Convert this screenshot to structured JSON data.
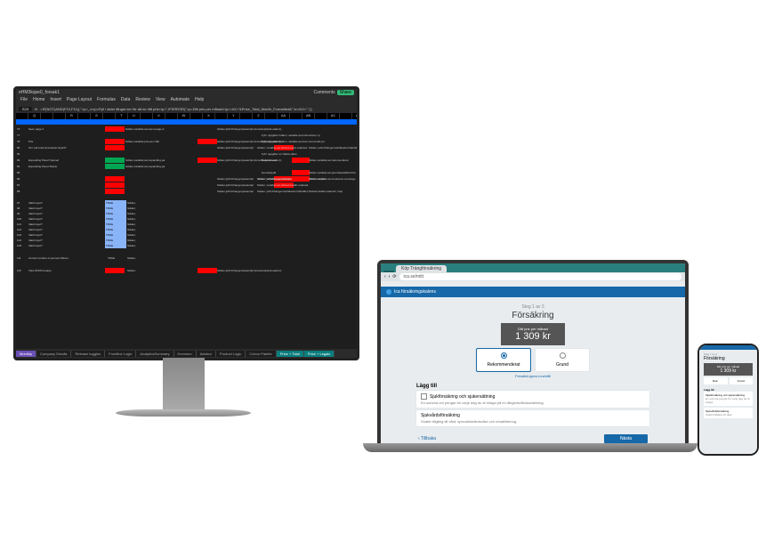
{
  "excel": {
    "filename": "eHM3kqse0_forsak1",
    "menu": [
      "File",
      "Home",
      "Insert",
      "Page Layout",
      "Formulas",
      "Data",
      "Review",
      "View",
      "Automate",
      "Help"
    ],
    "cell_ref": "B28",
    "formula": "=IF(NOT(AND(F10,F11)),\"<p>_x</p>Fyll i alder långst ner för att se ditt pris</p>\",IFERROR(\"<p>Ditt pris per månad</p><h2>\"&Price_Total_Month_Formatted&\" kr</h2>\",\"))",
    "comments_btn": "Comments",
    "share_btn": "Share",
    "columns": [
      "",
      "Q",
      "",
      "",
      "R",
      "",
      "S",
      "",
      "T",
      "U",
      "",
      "V",
      "",
      "W",
      "",
      "X",
      "",
      "Y",
      "",
      "Z",
      "",
      "AA",
      "",
      "AB",
      "",
      "AC",
      "",
      "AD"
    ],
    "rows_a": [
      {
        "n": "70",
        "label": "Seen page 2",
        "g": true,
        "txt": "hidden;variable;set;seen-page-2;",
        "r": true,
        "txt2": "hidden;jsOnChange=javascript;storeAnalyticsLoader();"
      },
      {
        "n": "77",
        "label": "",
        "txt3": "Fyll i uppgifter hidden; variable;set;instructions;<p"
      },
      {
        "n": "78",
        "label": "Pris",
        "r": true,
        "txt": "hidden;variable;pris-per-mån",
        "r2": true,
        "txt2": "hidden;jsOnChange=javascript;storeAnalyticsLoader();",
        "txt3": "Fyll i uppgifter hidden; variable;set;text-cont;email;p;Cl"
      },
      {
        "n": "80",
        "label": "Om valt rekommenderat skydd?",
        "r": true,
        "txt4": "hidden;jsOnChange=javascript",
        "r5": true,
        "txt5": "hidden; variable;set;clicked-basic-retained;",
        "txt6": "hidden; jsOnChange=setValueForVariable(\"clicked-basic-retained\",t"
      },
      {
        "n": "82",
        "label": "",
        "txt3": "Fyll i uppgifter on Nästa sidan"
      },
      {
        "n": "83",
        "label": "Expanding Panel Opened",
        "g": true,
        "txt": "hidden;variable;set;expanding-pa",
        "r2": true,
        "txt2": "hidden;jsOnChange=javascript;storeAnalyticsLoader();",
        "txt3": "Rekommend",
        "r6": true,
        "txt6": "hidden;variable;set;rekomenderat"
      },
      {
        "n": "84",
        "label": "Expanding Panel Status",
        "g2": true,
        "txt": "hidden;variable;set;expanding-pa"
      },
      {
        "n": "85",
        "label": "",
        "txt3": "Grundskydd",
        "r6": true,
        "txt6": "hidden;variable;set;grundskyddsOnCha"
      },
      {
        "n": "86",
        "label": "",
        "r": true,
        "txt4": "hidden;jsOnChange=javascript",
        "r5": true,
        "txt5": "hidden; variable;set;clicked-sys-retained;",
        "txt7": "hidden; jsOnChange=setValueForVariable(\"-Text In expan",
        "r6": true,
        "txt6": "hidden;variable;set;insurance-coverage"
      },
      {
        "n": "87",
        "label": "",
        "r": true,
        "txt4": "hidden;jsOnChange=javascript",
        "r5": true,
        "txt5": "hidden; variable;set;clicked-health-retained;"
      },
      {
        "n": "88",
        "label": "",
        "r": true,
        "txt4": "hidden;jsOnChange=javascript",
        "txt7": "hidden; jsOnChange=setValueForVariable(\"clicked-health-retained\",true)"
      }
    ],
    "valid_rows": [
      {
        "n": "97",
        "label": "Valid Input?",
        "val": "TRUE",
        "h": "hidden;"
      },
      {
        "n": "98",
        "label": "Valid Input?",
        "val": "TRUE",
        "h": "hidden;"
      },
      {
        "n": "99",
        "label": "Valid Input?",
        "val": "TRUE",
        "h": "hidden;"
      },
      {
        "n": "100",
        "label": "Valid Input?",
        "val": "TRUE",
        "h": "hidden;"
      },
      {
        "n": "101",
        "label": "Valid Input?",
        "val": "TRUE",
        "h": "hidden;"
      },
      {
        "n": "102",
        "label": "Valid Input?",
        "val": "TRUE",
        "h": "hidden;"
      },
      {
        "n": "103",
        "label": "Valid Input?",
        "val": "TRUE",
        "h": "hidden;"
      },
      {
        "n": "104",
        "label": "Valid Input?",
        "val": "TRUE",
        "h": "hidden;"
      },
      {
        "n": "105",
        "label": "Valid Input?",
        "val": "TRUE",
        "h": "hidden;"
      }
    ],
    "row_correct": {
      "n": "111",
      "label": "Correct number of persons filled o",
      "val": "TRUE",
      "h": "hidden;"
    },
    "row_last": {
      "n": "115",
      "label": "Visa NÄSTA-knapp",
      "r": true,
      "h": "hidden;",
      "r2": true,
      "txt2": "hidden;jsOnChange=javascript;storeAnalyticsLoader();"
    },
    "tabs": [
      "Monthly",
      "Company Details",
      "Release toggles",
      "Frontline Logic",
      "AnalyticsSummary",
      "Kommun",
      "Advisor",
      "Product Logic",
      "Colour Palette",
      "Price + Total",
      "Price + Legals"
    ]
  },
  "browser": {
    "tab_inactive": "",
    "tab_active": "Köp Trängförsäkring",
    "url": "ica.se/mitt",
    "brand": "Ica försäkringskalens",
    "step": "Steg 1 av 3",
    "title": "Försäkring",
    "price_label": "Ditt pris per månad",
    "price_value": "1 309 kr",
    "opt_a": "Rekommenderat",
    "opt_b": "Grund",
    "link": "Försäkringens innehåll",
    "section": "Lägg till",
    "item1_title": "Sjukförsäkring och sjukersättning",
    "item1_desc": "En summa om pengar för varje dag du är inlagd på en långtidsvårdsavdelning.",
    "item2_title": "Sjukvårdsförsäkring",
    "item2_desc": "Snabb tillgång till vård: specialistvårdsvård och rehabilitering.",
    "back": "Tillbaka",
    "next": "Nästa"
  },
  "phone": {
    "step": "Steg 1 av 3",
    "title": "Försäkring",
    "price_label": "Ditt pris per månad",
    "price_value": "1 309 kr",
    "opt_a": "Rek.",
    "opt_b": "Grund",
    "section": "Lägg till",
    "item1": "Sjukförsäkring och sjukersättning",
    "item1d": "En summa pengar för varje dag du är inlagd.",
    "item2": "Sjukvårdsförsäkring",
    "item2d": "Snabb tillgång till vård."
  }
}
